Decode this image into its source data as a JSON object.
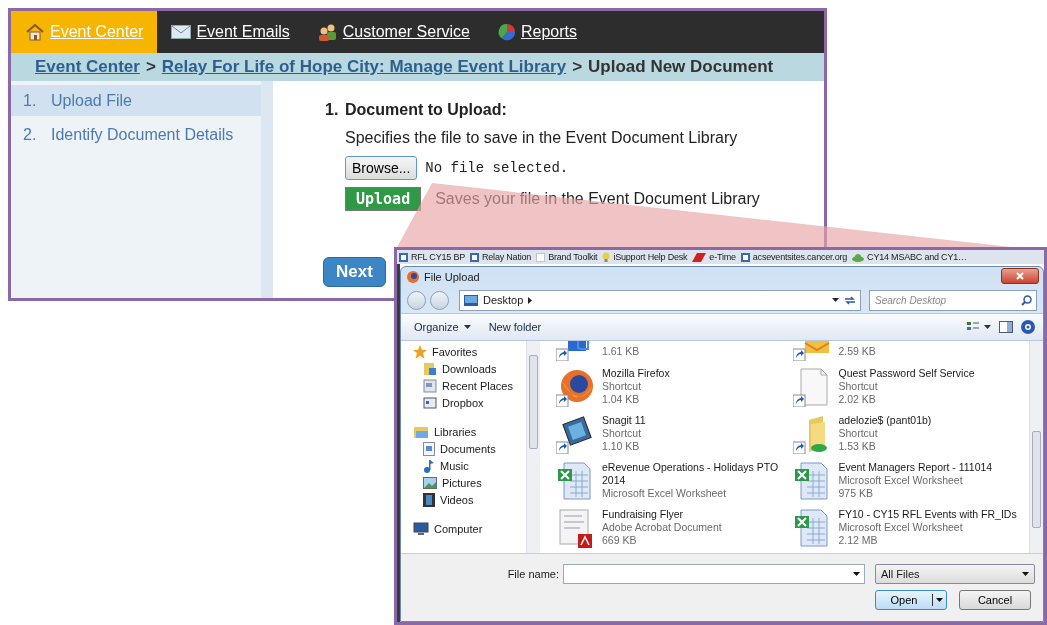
{
  "web_page": {
    "nav_tabs": [
      {
        "label": "Event Center",
        "selected": true
      },
      {
        "label": "Event Emails",
        "selected": false
      },
      {
        "label": "Customer Service",
        "selected": false
      },
      {
        "label": "Reports",
        "selected": false
      }
    ],
    "breadcrumb": [
      {
        "label": "Event Center",
        "kind": "link"
      },
      {
        "label": ">",
        "kind": "separator"
      },
      {
        "label": "Relay For Life of Hope City: Manage Event Library",
        "kind": "link"
      },
      {
        "label": ">",
        "kind": "separator"
      },
      {
        "label": "Upload New Document",
        "kind": "current"
      }
    ],
    "steps": [
      {
        "number": "1.",
        "label": "Upload File",
        "selected": true
      },
      {
        "number": "2.",
        "label": "Identify Document Details",
        "selected": false
      }
    ],
    "section": {
      "number": "1.",
      "title": "Document to Upload:",
      "description": "Specifies the file to save in the Event Document Library"
    },
    "browse_button": "Browse...",
    "file_status": "No file selected.",
    "upload_button": "Upload",
    "upload_note": "Saves your file in the Event Document Library",
    "next_button": "Next"
  },
  "callout": {
    "bookmarks": [
      "RFL CY15 BP",
      "Relay Nation",
      "Brand Toolkit",
      "iSupport Help Desk",
      "e-Time",
      "acseventsites.cancer.org",
      "CY14 MSABC and CY1…"
    ],
    "dialog": {
      "title": "File Upload",
      "address": "Desktop",
      "search_placeholder": "Search Desktop",
      "toolbar": [
        "Organize",
        "New folder"
      ],
      "navigation": [
        {
          "label": "Favorites",
          "kind": "star",
          "children": [
            {
              "label": "Downloads",
              "kind": "folder"
            },
            {
              "label": "Recent Places",
              "kind": "places"
            },
            {
              "label": "Dropbox",
              "kind": "box"
            }
          ]
        },
        {
          "label": "Libraries",
          "kind": "library",
          "children": [
            {
              "label": "Documents",
              "kind": "doc"
            },
            {
              "label": "Music",
              "kind": "note"
            },
            {
              "label": "Pictures",
              "kind": "picture"
            },
            {
              "label": "Videos",
              "kind": "film"
            }
          ]
        },
        {
          "label": "Computer",
          "kind": "computer"
        }
      ],
      "files": [
        {
          "size": "1.61 KB",
          "kind": "app"
        },
        {
          "size": "2.59 KB",
          "kind": "mail"
        },
        {
          "name": "Mozilla Firefox",
          "type": "Shortcut",
          "size": "1.04 KB",
          "kind": "firefox"
        },
        {
          "name": "Quest Password Self Service",
          "type": "Shortcut",
          "size": "2.02 KB",
          "kind": "document"
        },
        {
          "name": "Snagit 11",
          "type": "Shortcut",
          "size": "1.10 KB",
          "kind": "snagit"
        },
        {
          "name": "adelozie$ (pant01b)",
          "type": "Shortcut",
          "size": "1.53 KB",
          "kind": "folder"
        },
        {
          "name": "eRevenue Operations - Holidays PTO 2014",
          "type": "Microsoft Excel Worksheet",
          "kind": "excel"
        },
        {
          "name": "Event Managers Report - 111014",
          "type": "Microsoft Excel Worksheet",
          "size": "975 KB",
          "kind": "excel"
        },
        {
          "name": "Fundraising Flyer",
          "type": "Adobe Acrobat Document",
          "size": "669 KB",
          "kind": "pdf"
        },
        {
          "name": "FY10 - CY15 RFL Events with FR_IDs",
          "type": "Microsoft Excel Worksheet",
          "size": "2.12 MB",
          "kind": "excel"
        }
      ],
      "file_name_label": "File name:",
      "file_type": "All Files",
      "buttons": [
        {
          "label": "Open",
          "kind": "split"
        },
        {
          "label": "Cancel",
          "kind": "plain"
        }
      ]
    }
  }
}
